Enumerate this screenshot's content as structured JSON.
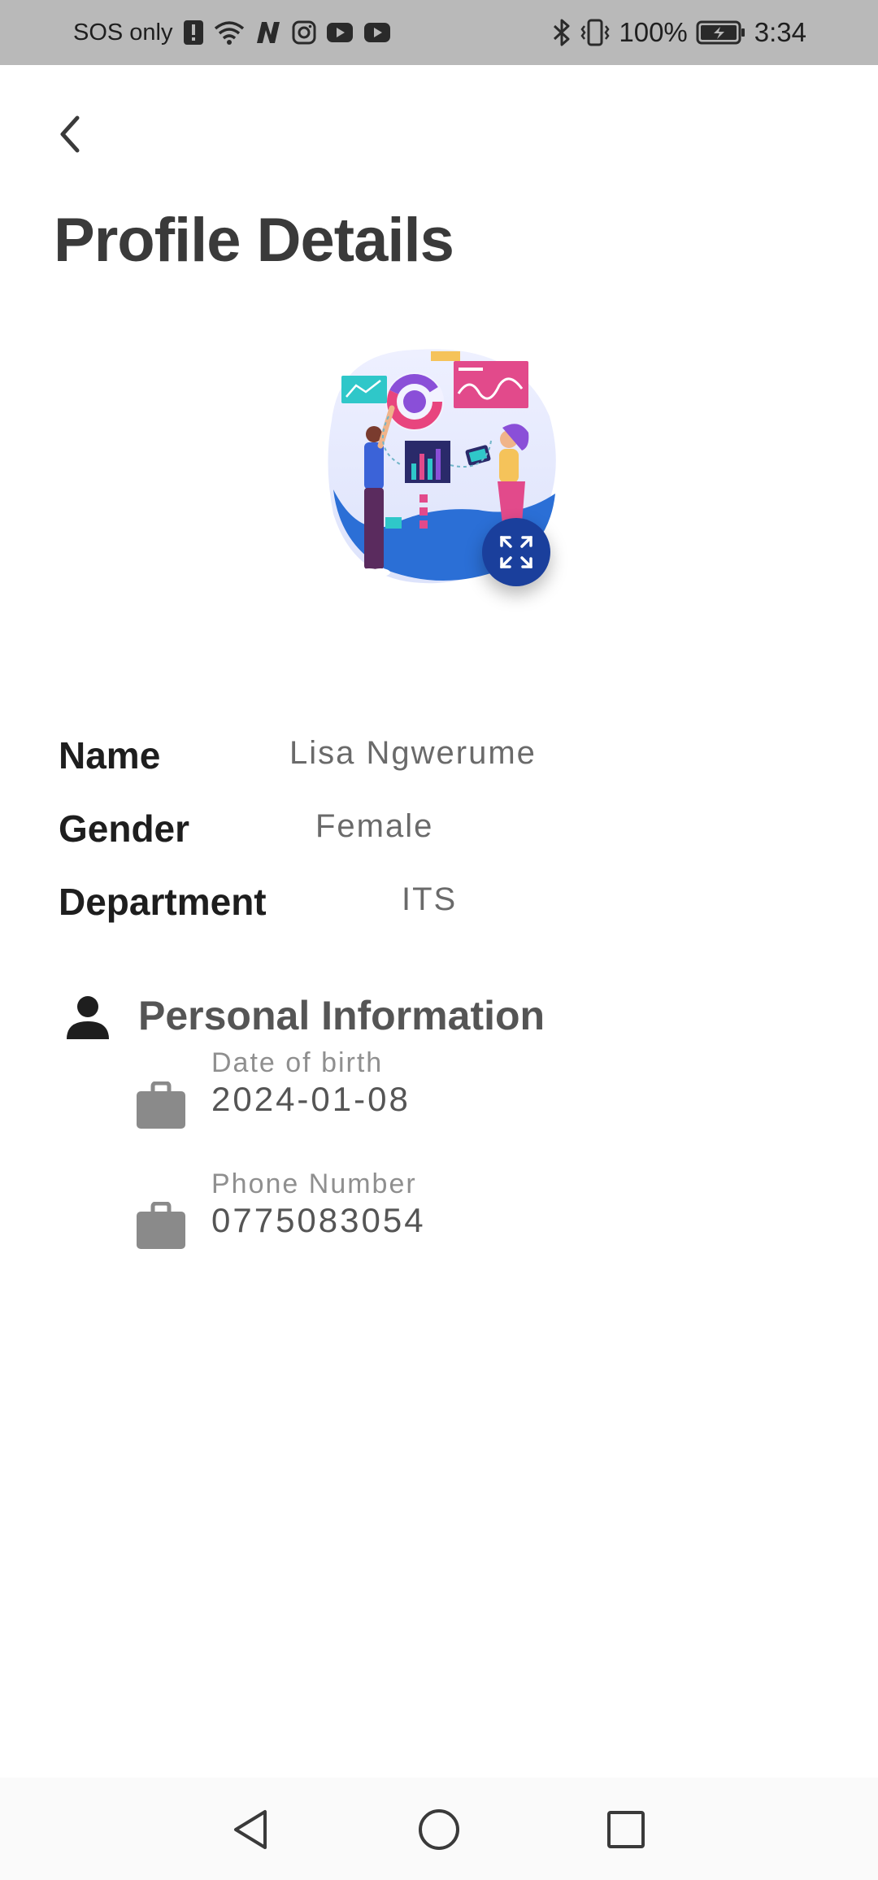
{
  "status_bar": {
    "carrier": "SOS only",
    "left_icons": [
      "alert-icon",
      "wifi-icon",
      "n-app-icon",
      "instagram-icon",
      "youtube-icon",
      "youtube-icon"
    ],
    "right_icons": [
      "bluetooth-icon",
      "vibrate-icon",
      "battery-icon"
    ],
    "battery": "100%",
    "time": "3:34"
  },
  "header": {
    "back_icon": "chevron-left-icon",
    "title": "Profile Details"
  },
  "profile": {
    "illustration": "analytics-illustration",
    "expand_icon": "expand-icon",
    "details": [
      {
        "label": "Name",
        "value": "Lisa Ngwerume"
      },
      {
        "label": "Gender",
        "value": "Female"
      },
      {
        "label": "Department",
        "value": "ITS"
      }
    ]
  },
  "personal_info": {
    "icon": "person-icon",
    "title": "Personal Information",
    "items": [
      {
        "icon": "briefcase-icon",
        "label": "Date of birth",
        "value": "2024-01-08"
      },
      {
        "icon": "briefcase-icon",
        "label": "Phone Number",
        "value": "0775083054"
      }
    ]
  },
  "nav_bar": {
    "icons": [
      "back-triangle-icon",
      "home-circle-icon",
      "recents-square-icon"
    ]
  },
  "colors": {
    "status_bar_bg": "#b9b9b9",
    "title_text": "#3a3a3a",
    "accent": "#1a3f9c",
    "label_text": "#1e1e1e",
    "value_text": "#6a6a6a"
  }
}
